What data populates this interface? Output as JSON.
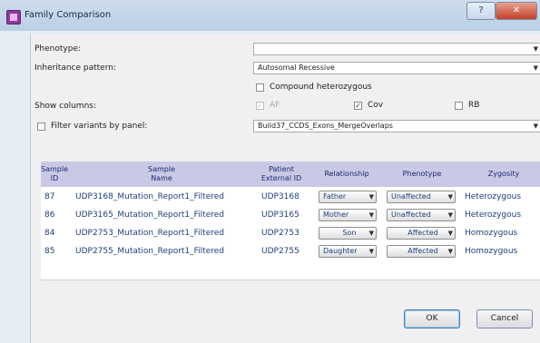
{
  "window": {
    "title": "Family Comparison",
    "help_label": "?",
    "close_label": "✕"
  },
  "form": {
    "phenotype_label": "Phenotype:",
    "phenotype_value": "",
    "inheritance_label": "Inheritance pattern:",
    "inheritance_value": "Autosomal Recessive",
    "compound_label": "Compound heterozygous",
    "compound_checked": false,
    "show_columns_label": "Show columns:",
    "columns": [
      {
        "label": "AF",
        "checked": true,
        "disabled": true
      },
      {
        "label": "Cov",
        "checked": true,
        "disabled": false
      },
      {
        "label": "RB",
        "checked": false,
        "disabled": false
      }
    ],
    "filter_label": "Filter variants by panel:",
    "filter_checked": false,
    "panel_value": "Build37_CCDS_Exons_MergeOverlaps"
  },
  "table": {
    "headers": {
      "sample_id": [
        "Sample",
        "ID"
      ],
      "sample_name": [
        "Sample",
        "Name"
      ],
      "patient_id": [
        "Patient",
        "External ID"
      ],
      "relationship": "Relationship",
      "phenotype": "Phenotype",
      "zygosity": "Zygosity"
    },
    "rows": [
      {
        "id": "87",
        "name": "UDP3168_Mutation_Report1_Filtered",
        "patient": "UDP3168",
        "relationship": "Father",
        "phenotype": "Unaffected",
        "zygosity": "Heterozygous"
      },
      {
        "id": "86",
        "name": "UDP3165_Mutation_Report1_Filtered",
        "patient": "UDP3165",
        "relationship": "Mother",
        "phenotype": "Unaffected",
        "zygosity": "Heterozygous"
      },
      {
        "id": "84",
        "name": "UDP2753_Mutation_Report1_Filtered",
        "patient": "UDP2753",
        "relationship": "Son",
        "phenotype": "Affected",
        "zygosity": "Homozygous"
      },
      {
        "id": "85",
        "name": "UDP2755_Mutation_Report1_Filtered",
        "patient": "UDP2755",
        "relationship": "Daughter",
        "phenotype": "Affected",
        "zygosity": "Homozygous"
      }
    ]
  },
  "buttons": {
    "ok": "OK",
    "cancel": "Cancel"
  },
  "colors": {
    "header_bg": "#c9c9e6",
    "row_text": "#1f3f7a",
    "app_icon": "#8e3a9a"
  }
}
